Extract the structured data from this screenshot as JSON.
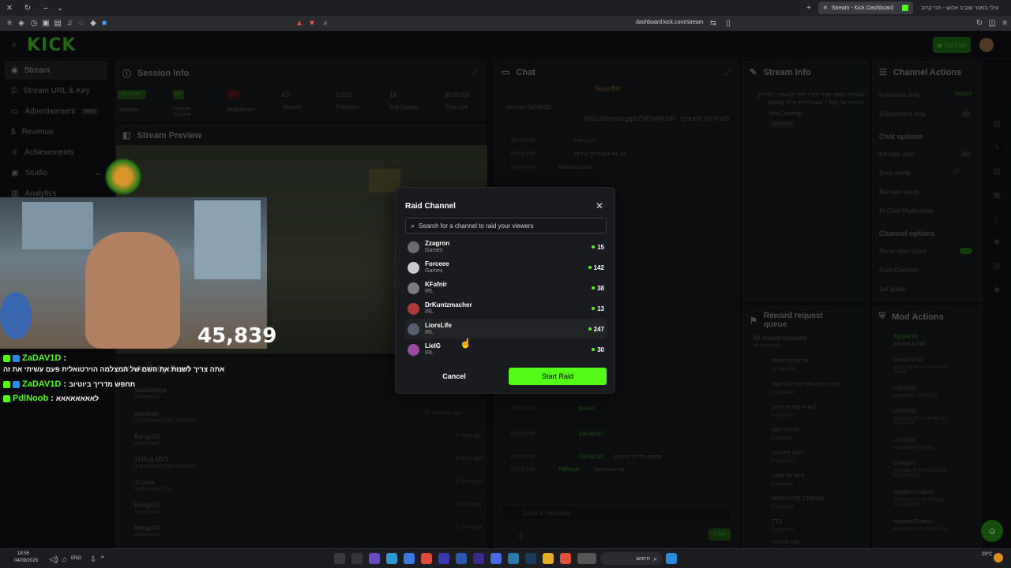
{
  "browser": {
    "tabs": [
      {
        "label": "Stream - Kick Dashboard",
        "active": true
      },
      {
        "label": "עילי בסטר שוביב אלוש - הכי קרוב",
        "active": false
      }
    ],
    "url": "dashboard.kick.com/stream"
  },
  "topnav": {
    "logo": "KICK",
    "go_live": "Go Live"
  },
  "sidebar": {
    "items": [
      {
        "label": "Stream",
        "icon": "stream-icon"
      },
      {
        "label": "Stream URL & Key",
        "icon": "key-icon"
      },
      {
        "label": "Advertisement",
        "badge": "Beta",
        "icon": "ad-icon"
      },
      {
        "label": "Revenue",
        "icon": "dollar-icon"
      },
      {
        "label": "Achievements",
        "icon": "trophy-icon"
      },
      {
        "label": "Studio",
        "icon": "studio-icon"
      },
      {
        "label": "Analytics",
        "icon": "chart-icon"
      }
    ]
  },
  "session": {
    "title": "Session Info",
    "stats": [
      {
        "value": "HEALTHY",
        "label": "Session"
      },
      {
        "value": "ON",
        "label": "Partner Income"
      },
      {
        "value": "OFF",
        "label": "Multistream"
      },
      {
        "value": "63",
        "label": "Viewers"
      },
      {
        "value": "5,022",
        "label": "Followers"
      },
      {
        "value": "19",
        "label": "Sub Counts"
      },
      {
        "value": "06:05:58",
        "label": "Time Live"
      }
    ]
  },
  "preview": {
    "title": "Stream Preview",
    "viewers": "45,839"
  },
  "overlay_chat": [
    {
      "user": "ZaDAV1D",
      "text": "אתה צריך לשנות את השם של המצלמה הוירטואלית פעם עשיתי את זה"
    },
    {
      "user": "ZaDAV1D",
      "text": "תחפש מדריך ביוטיוב"
    },
    {
      "user": "PdlNoob",
      "text": "לאאאאאאאא"
    }
  ],
  "activity": {
    "title": "Activity Feed",
    "items": [
      {
        "user": "Nadabooya",
        "action": "redeemed",
        "time": ""
      },
      {
        "user": "basakaki",
        "action": "just followed the channel",
        "time": "58 minutes ago"
      },
      {
        "user": "Bengo23",
        "action": "redeemed",
        "time": "1 hour ago"
      },
      {
        "user": "SHAULMV3",
        "action": "just followed the channel",
        "time": "1 hour ago"
      },
      {
        "user": "1Come",
        "action": "redeemed TTS",
        "time": "1 hour ago"
      },
      {
        "user": "Bengo23",
        "action": "redeemed",
        "time": "1 hour ago"
      },
      {
        "user": "Bengo23",
        "action": "redeemed",
        "time": "1 hour ago"
      }
    ]
  },
  "chat": {
    "title": "Chat",
    "superbit": "SuperBit!",
    "sent_by": "Sent by ZaDAV1D",
    "pinned": "לשרת של הסטרים : https://discord.gg/eZVF5eWGbN",
    "lines": [
      {
        "time": "06:49 PM",
        "user": "",
        "text": "יא בן זונה"
      },
      {
        "time": "06:50 PM",
        "user": "",
        "text": "אני לא אשנה לך את זה"
      },
      {
        "time": "06:50 PM",
        "user": "ethancoconut",
        "text": "בוא נואו גיבוקס"
      },
      {
        "time": "06:54 PM",
        "user": "BotRix",
        "text": "תעקבו אחרי ב אינסטגרם: https://www.instagram.com/boazshop/"
      },
      {
        "time": "06:54 PM",
        "user": "ZaDAV1D",
        "text": "אתה צריך לשנות את השם של המצלמה הוירטואלית פעם עשיתי את זה"
      },
      {
        "time": "06:55 PM",
        "user": "ZaDAV1D",
        "text": "תחפש מדריך ביוטיוב"
      },
      {
        "time": "06:55 PM",
        "user": "PdlNoob",
        "text": "לאאאאאאאא"
      }
    ],
    "placeholder": "Send a message",
    "send": "Chat",
    "count": "0"
  },
  "stream_info": {
    "title": "Stream Info",
    "stream_title": "נשברתי שואגי סטריטס + חוזר לעשמי + זנטריק בדלפה על מקל + מצגן דרדס זכייה מושלם",
    "category": "Just Chatting",
    "language": "Hebrew"
  },
  "channel_actions": {
    "title": "Channel Actions",
    "rows": [
      {
        "label": "Followers only",
        "value": "Instant"
      },
      {
        "label": "Subscribers only",
        "value": ""
      },
      {
        "label": "Chat options",
        "value": "",
        "heading": true
      },
      {
        "label": "Emotes only",
        "value": ""
      },
      {
        "label": "Slow mode",
        "value": "Off"
      },
      {
        "label": "Banned words",
        "value": ""
      },
      {
        "label": "AI Chat Moderation",
        "value": ""
      },
      {
        "label": "Channel options",
        "value": "",
        "heading": true
      },
      {
        "label": "Show view count",
        "value": ""
      },
      {
        "label": "Raid Channel",
        "value": ""
      },
      {
        "label": "Set goals",
        "value": ""
      }
    ]
  },
  "rewards": {
    "title": "Reward request queue",
    "all": "All reward requests",
    "all_count": "66 requests",
    "items": [
      {
        "name": "הודעת מרציונות",
        "count": "11 requests"
      },
      {
        "name": "להבין מילה מטייטנת לכן דקות",
        "count": "6 requests"
      },
      {
        "name": "לשנות כותרת לאייב",
        "count": "6 requests"
      },
      {
        "name": "לאיתורי סים",
        "count": "6 requests"
      },
      {
        "name": "ניצוץ לתושיות",
        "count": "6 requests"
      },
      {
        "name": "מיום של המנכ",
        "count": "6 requests"
      },
      {
        "name": "ABSOLUTE CINEMA",
        "count": "6 requests"
      },
      {
        "name": "TTS",
        "count": "6 requests"
      },
      {
        "name": "מנה מהביוס",
        "count": "6 requests"
      }
    ]
  },
  "mod_actions": {
    "title": "Mod Actions",
    "items": [
      {
        "user": "ZaDAV1D",
        "action": "started a Poll",
        "time": "1 hour ago"
      },
      {
        "user": "liay1231011",
        "action": "timed out for 5 minutes by Skoiet",
        "time": "1 hour ago"
      },
      {
        "user": "L33333D",
        "action": "banned by ZaDAV1D",
        "time": "1 hour ago"
      },
      {
        "user": "L33333D",
        "action": "timed out for 1 minute by ZaDAV1D",
        "time": "1 hour ago"
      },
      {
        "user": "L33333D",
        "action": "banned by Forcees",
        "time": "1 hour ago"
      },
      {
        "user": "Category",
        "action": "changed to Just Chatting by ZaDAV1D",
        "time": "1 hour ago"
      },
      {
        "user": "YahalomTzahov",
        "action": "timed out for 10 minutes by ZaDAV1D",
        "time": "1 hour ago"
      },
      {
        "user": "YahalomTzahov",
        "action": "timed out for 5 minutes by",
        "time": "1 hour ago"
      }
    ]
  },
  "raid_modal": {
    "title": "Raid Channel",
    "search_placeholder": "Search for a channel to raid your viewers",
    "channels": [
      {
        "name": "Zzagron",
        "category": "Games",
        "viewers": "15",
        "color": "#6b6b6b"
      },
      {
        "name": "Forceee",
        "category": "Games",
        "viewers": "142",
        "color": "#c9c9c9"
      },
      {
        "name": "KFafnir",
        "category": "IRL",
        "viewers": "38",
        "color": "#7a7b80"
      },
      {
        "name": "DrKuntzmacher",
        "category": "IRL",
        "viewers": "13",
        "color": "#b03a3a"
      },
      {
        "name": "LiorsLife",
        "category": "IRL",
        "viewers": "247",
        "color": "#556070"
      },
      {
        "name": "LieIG",
        "category": "IRL",
        "viewers": "30",
        "color": "#9a4aa0"
      }
    ],
    "cancel": "Cancel",
    "start": "Start Raid"
  },
  "taskbar": {
    "time": "18:55",
    "date": "04/09/2026",
    "lang": "ENG",
    "search": "חיפוש",
    "weather": "29°C"
  },
  "colors": {
    "accent": "#53fc18",
    "bg": "#0e0f11"
  }
}
